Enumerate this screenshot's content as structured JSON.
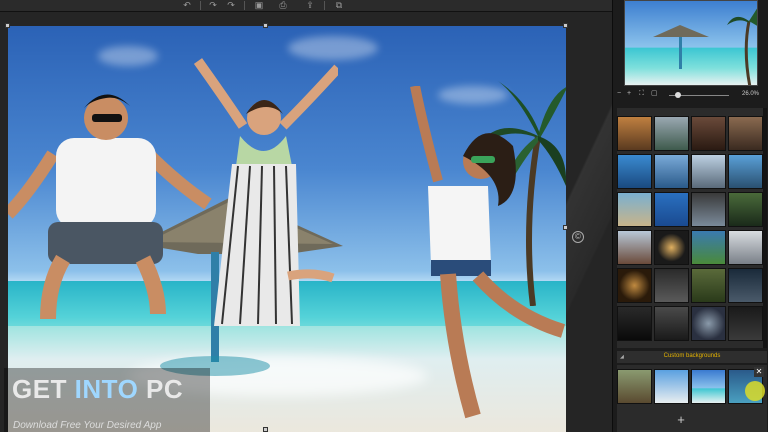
{
  "toolbar": {
    "tools": [
      {
        "name": "undo-icon",
        "glyph": "↶"
      },
      {
        "name": "redo-icon",
        "glyph": "↷"
      },
      {
        "name": "redo-alt-icon",
        "glyph": "↷"
      },
      {
        "name": "save-icon",
        "glyph": "▣"
      },
      {
        "name": "print-icon",
        "glyph": "⎙"
      },
      {
        "name": "share-icon",
        "glyph": "⇪"
      },
      {
        "name": "export-icon",
        "glyph": "⧉"
      }
    ]
  },
  "canvas": {
    "copyright_glyph": "©"
  },
  "watermark": {
    "title_part1": "GET ",
    "title_part2": "INTO",
    "title_part3": " PC",
    "subtitle": "Download Free Your Desired App"
  },
  "panel": {
    "zoom_value": "26.0%",
    "zoom_in_icon": "+",
    "zoom_out_icon": "−",
    "custom_backgrounds_label": "Custom backgrounds",
    "add_icon": "+",
    "close_icon": "✕"
  },
  "colors": {
    "accent": "#e6b400",
    "panel_bg": "#1c1c1c",
    "toolbar_bg": "#2b2b2b"
  }
}
